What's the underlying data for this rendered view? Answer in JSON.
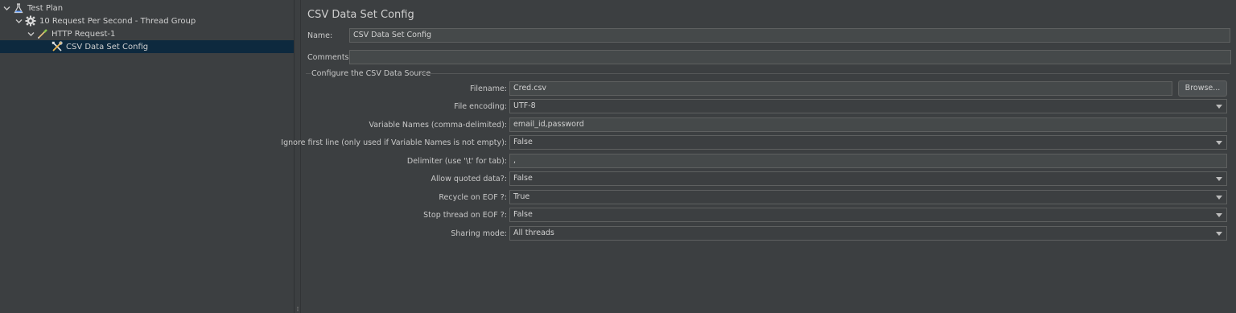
{
  "tree": {
    "items": [
      {
        "label": "Test Plan",
        "icon": "flask-icon",
        "expanded": true
      },
      {
        "label": "10 Request Per Second - Thread Group",
        "icon": "gear-icon",
        "expanded": true
      },
      {
        "label": "HTTP Request-1",
        "icon": "pipette-icon",
        "expanded": true
      },
      {
        "label": "CSV Data Set Config",
        "icon": "tools-icon",
        "selected": true
      }
    ]
  },
  "panel": {
    "title": "CSV Data Set Config",
    "name_label": "Name:",
    "name_value": "CSV Data Set Config",
    "comments_label": "Comments:",
    "comments_value": "",
    "group_title": "Configure the CSV Data Source",
    "filename_label": "Filename:",
    "filename_value": "Cred.csv",
    "browse_label": "Browse...",
    "encoding_label": "File encoding:",
    "encoding_value": "UTF-8",
    "varnames_label": "Variable Names (comma-delimited):",
    "varnames_value": "email_id,password",
    "ignore_label": "Ignore first line (only used if Variable Names is not empty):",
    "ignore_value": "False",
    "delimiter_label": "Delimiter (use '\\t' for tab):",
    "delimiter_value": ",",
    "quoted_label": "Allow quoted data?:",
    "quoted_value": "False",
    "recycle_label": "Recycle on EOF ?:",
    "recycle_value": "True",
    "stop_label": "Stop thread on EOF ?:",
    "stop_value": "False",
    "sharing_label": "Sharing mode:",
    "sharing_value": "All threads"
  },
  "colors": {
    "background": "#3c3f41",
    "selection": "#0d293e",
    "field": "#45494a",
    "border": "#5e6060"
  }
}
